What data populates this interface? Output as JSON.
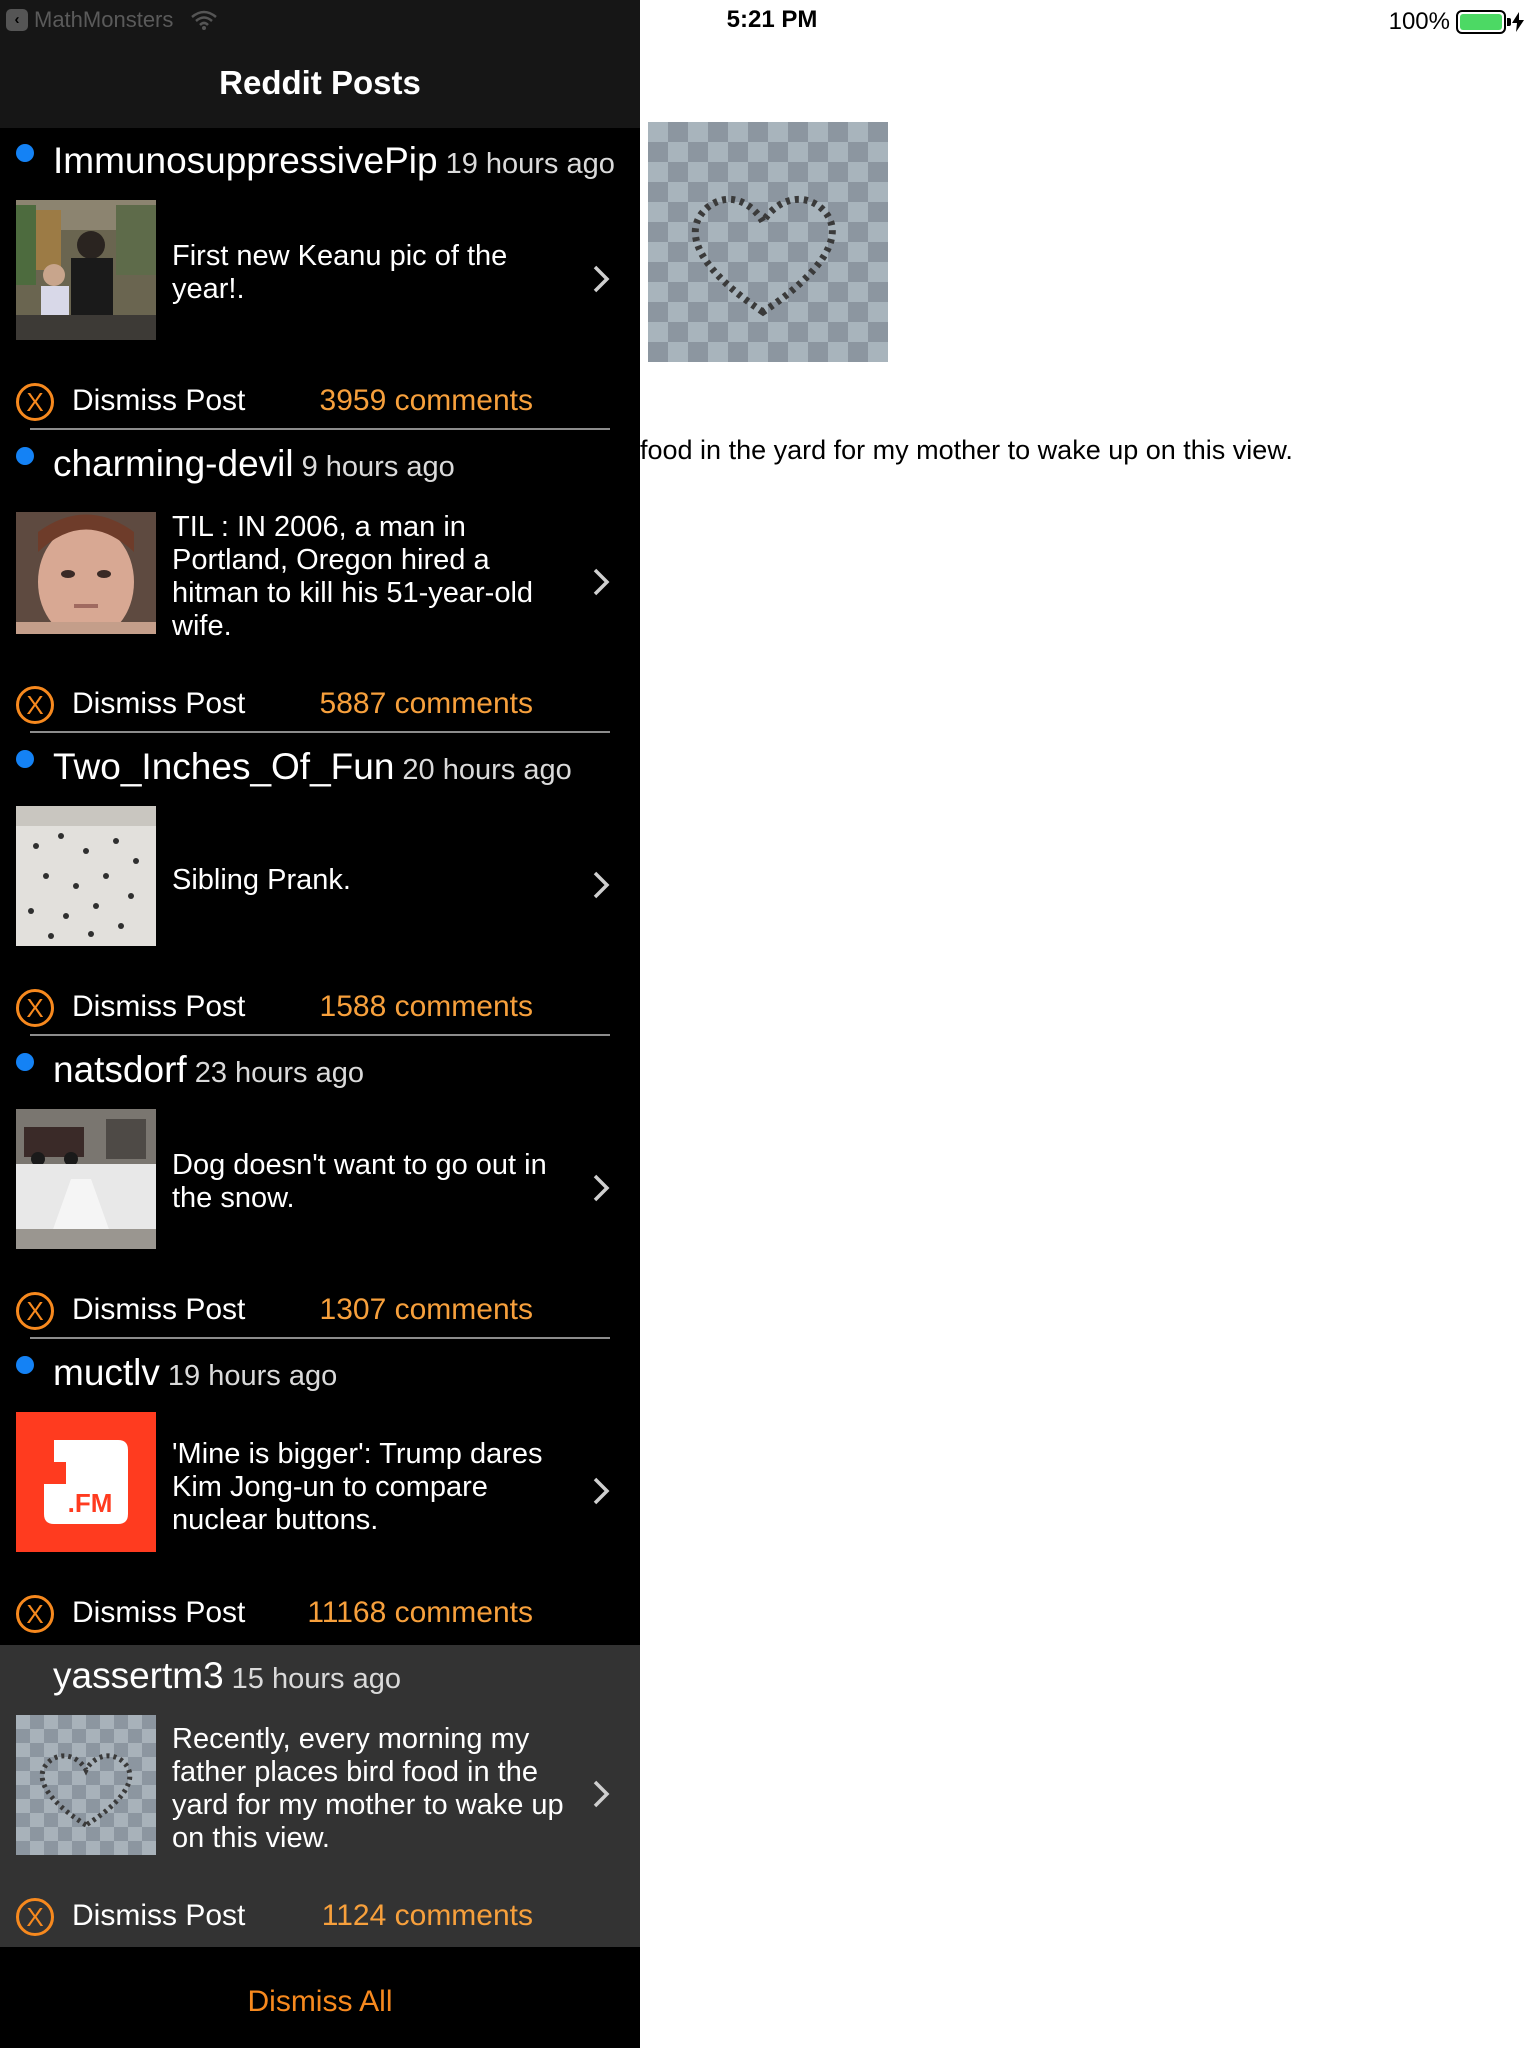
{
  "status_bar": {
    "back_app": "MathMonsters",
    "time": "5:21 PM",
    "battery": "100%",
    "battery_level_percent": 100
  },
  "sidebar": {
    "title": "Reddit Posts",
    "dismiss_all": "Dismiss All",
    "posts": [
      {
        "author": "ImmunosuppressivePip",
        "time": "19 hours ago",
        "title": "First new Keanu pic of the year!.",
        "dismiss": "Dismiss Post",
        "comments": "3959 comments",
        "unread": true
      },
      {
        "author": "charming-devil",
        "time": "9 hours ago",
        "title": "TIL : IN 2006, a man in Portland, Oregon hired a hitman to kill his 51-year-old wife.",
        "dismiss": "Dismiss Post",
        "comments": "5887 comments",
        "unread": true
      },
      {
        "author": "Two_Inches_Of_Fun",
        "time": "20 hours ago",
        "title": "Sibling Prank.",
        "dismiss": "Dismiss Post",
        "comments": "1588 comments",
        "unread": true
      },
      {
        "author": "natsdorf",
        "time": "23 hours ago",
        "title": "Dog doesn't want to go out in the snow.",
        "dismiss": "Dismiss Post",
        "comments": "1307 comments",
        "unread": true
      },
      {
        "author": "muctlv",
        "time": "19 hours ago",
        "title": "'Mine is bigger': Trump dares Kim Jong-un to compare nuclear buttons.",
        "dismiss": "Dismiss Post",
        "comments": "11168 comments",
        "unread": true,
        "thumb_text": ".FM"
      },
      {
        "author": "yassertm3",
        "time": "15 hours ago",
        "title": "Recently, every morning my father places bird food in the yard for my mother to wake up on this view.",
        "dismiss": "Dismiss Post",
        "comments": "1124 comments",
        "unread": false,
        "selected": true
      }
    ]
  },
  "detail": {
    "text": "food in the yard for my mother to wake up on this view."
  },
  "colors": {
    "accent": "#f7891e",
    "comments": "#f7a03c",
    "unread": "#1482f5",
    "selected_row": "#333333",
    "battery": "#4cd964"
  }
}
